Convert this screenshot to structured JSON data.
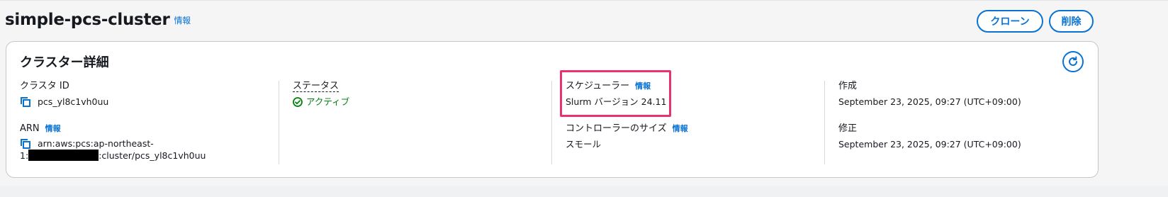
{
  "header": {
    "title": "simple-pcs-cluster",
    "info": "情報",
    "clone_label": "クローン",
    "delete_label": "削除"
  },
  "card": {
    "title": "クラスター詳細",
    "cluster_id": {
      "label": "クラスタ ID",
      "value": "pcs_yl8c1vh0uu"
    },
    "arn": {
      "label": "ARN",
      "info": "情報",
      "line1": "arn:aws:pcs:ap-northeast-",
      "prefix": "1:",
      "suffix": ":cluster/pcs_yl8c1vh0uu"
    },
    "status": {
      "label": "ステータス",
      "value": "アクティブ"
    },
    "scheduler": {
      "label": "スケジューラー",
      "info": "情報",
      "value": "Slurm バージョン 24.11"
    },
    "controller_size": {
      "label": "コントローラーのサイズ",
      "info": "情報",
      "value": "スモール"
    },
    "created": {
      "label": "作成",
      "value": "September 23, 2025, 09:27 (UTC+09:00)"
    },
    "modified": {
      "label": "修正",
      "value": "September 23, 2025, 09:27 (UTC+09:00)"
    }
  },
  "colors": {
    "accent": "#0972d3",
    "success": "#037f0c",
    "highlight": "#e8336e"
  },
  "icons": [
    "copy-icon",
    "refresh-icon",
    "status-success-icon"
  ]
}
